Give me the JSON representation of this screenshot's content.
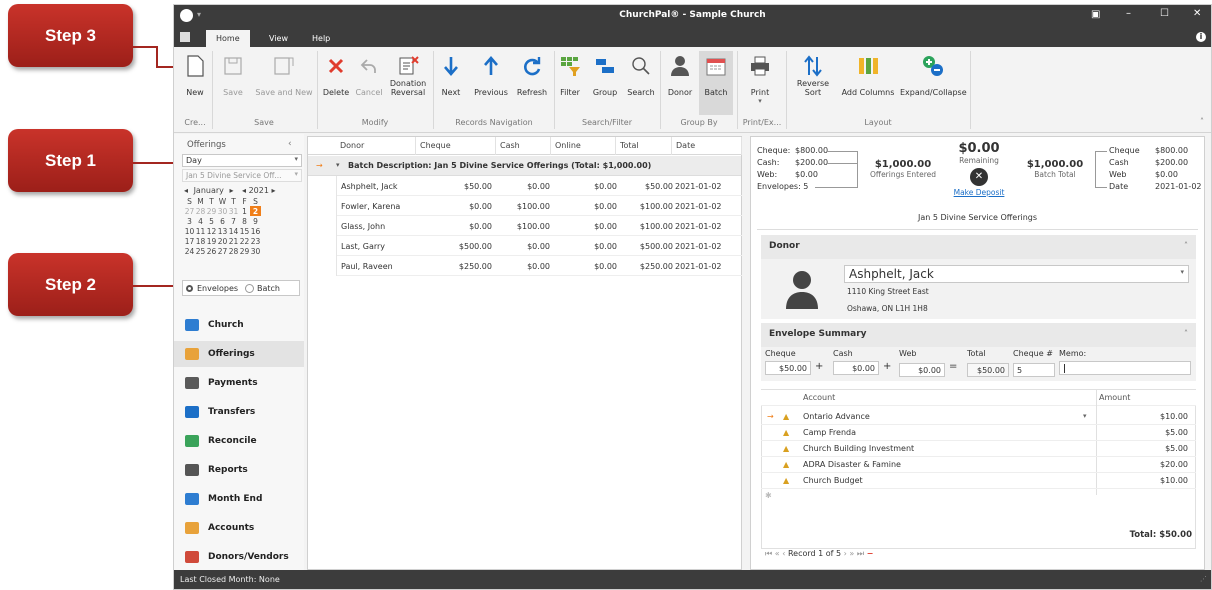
{
  "callouts": {
    "step3": "Step 3",
    "step1": "Step 1",
    "step2": "Step 2"
  },
  "window": {
    "title": "ChurchPal® - Sample Church"
  },
  "tabs": [
    "Home",
    "View",
    "Help"
  ],
  "ribbon": {
    "buttons": {
      "new": "New",
      "save": "Save",
      "save_and_new": "Save and New",
      "delete": "Delete",
      "cancel": "Cancel",
      "donation_reversal_1": "Donation",
      "donation_reversal_2": "Reversal",
      "next": "Next",
      "previous": "Previous",
      "refresh": "Refresh",
      "filter": "Filter",
      "group": "Group",
      "search": "Search",
      "donor": "Donor",
      "batch": "Batch",
      "print": "Print",
      "reverse_sort_1": "Reverse",
      "reverse_sort_2": "Sort",
      "add_columns": "Add Columns",
      "expand_collapse": "Expand/Collapse"
    },
    "groups": {
      "create": "Cre...",
      "save": "Save",
      "modify": "Modify",
      "records_navigation": "Records Navigation",
      "search_filter": "Search/Filter",
      "group_by": "Group By",
      "print_export": "Print/Ex...",
      "layout": "Layout"
    }
  },
  "left": {
    "title": "Offerings",
    "view_select": "Day",
    "batch_select": "Jan 5 Divine Service Off...",
    "calendar": {
      "month": "January",
      "year": "2021",
      "days_header": [
        "S",
        "M",
        "T",
        "W",
        "T",
        "F",
        "S"
      ],
      "weeks": [
        [
          "27",
          "28",
          "29",
          "30",
          "31",
          "1",
          "2"
        ],
        [
          "3",
          "4",
          "5",
          "6",
          "7",
          "8",
          "9"
        ],
        [
          "10",
          "11",
          "12",
          "13",
          "14",
          "15",
          "16"
        ],
        [
          "17",
          "18",
          "19",
          "20",
          "21",
          "22",
          "23"
        ],
        [
          "24",
          "25",
          "26",
          "27",
          "28",
          "29",
          "30"
        ]
      ]
    },
    "radio_envelopes": "Envelopes",
    "radio_batch": "Batch",
    "nav": [
      "Church",
      "Offerings",
      "Payments",
      "Transfers",
      "Reconcile",
      "Reports",
      "Month End",
      "Accounts",
      "Donors/Vendors"
    ]
  },
  "grid": {
    "columns": [
      "Donor",
      "Cheque",
      "Cash",
      "Online",
      "Total",
      "Date"
    ],
    "group_row": "Batch Description: Jan 5 Divine Service Offerings (Total: $1,000.00)",
    "rows": [
      [
        "Ashphelt, Jack",
        "$50.00",
        "$0.00",
        "$0.00",
        "$50.00",
        "2021-01-02"
      ],
      [
        "Fowler, Karena",
        "$0.00",
        "$100.00",
        "$0.00",
        "$100.00",
        "2021-01-02"
      ],
      [
        "Glass, John",
        "$0.00",
        "$100.00",
        "$0.00",
        "$100.00",
        "2021-01-02"
      ],
      [
        "Last, Garry",
        "$500.00",
        "$0.00",
        "$0.00",
        "$500.00",
        "2021-01-02"
      ],
      [
        "Paul, Raveen",
        "$250.00",
        "$0.00",
        "$0.00",
        "$250.00",
        "2021-01-02"
      ]
    ]
  },
  "summary": {
    "left_labels": [
      "Cheque:",
      "Cash:",
      "Web:",
      "Envelopes: 5"
    ],
    "left_values": [
      "$800.00",
      "$200.00",
      "$0.00",
      ""
    ],
    "offerings_entered_amount": "$1,000.00",
    "offerings_entered_label": "Offerings Entered",
    "remaining_amount": "$0.00",
    "remaining_label": "Remaining",
    "make_deposit": "Make Deposit",
    "batch_total_amount": "$1,000.00",
    "batch_total_label": "Batch Total",
    "right_labels": [
      "Cheque",
      "Cash",
      "Web",
      "Date"
    ],
    "right_values": [
      "$800.00",
      "$200.00",
      "$0.00",
      "2021-01-02"
    ],
    "batch_name": "Jan 5 Divine Service Offerings"
  },
  "donor": {
    "header": "Donor",
    "name": "Ashphelt, Jack",
    "address1": "1110 King Street East",
    "address2": "Oshawa, ON L1H 1H8"
  },
  "envelope": {
    "header": "Envelope Summary",
    "labels": [
      "Cheque",
      "Cash",
      "Web",
      "Total",
      "Cheque #",
      "Memo:"
    ],
    "cheque": "$50.00",
    "cash": "$0.00",
    "web": "$0.00",
    "total": "$50.00",
    "cheque_no": "5",
    "memo": "",
    "accounts_header": [
      "Account",
      "Amount"
    ],
    "accounts": [
      [
        "Ontario Advance",
        "$10.00"
      ],
      [
        "Camp Frenda",
        "$5.00"
      ],
      [
        "Church Building Investment",
        "$5.00"
      ],
      [
        "ADRA Disaster & Famine",
        "$20.00"
      ],
      [
        "Church Budget",
        "$10.00"
      ]
    ],
    "total_label": "Total: $50.00",
    "record_nav": "Record 1 of 5"
  },
  "statusbar": "Last Closed Month: None",
  "colors": {
    "accent_red": "#b22a22",
    "titlebar": "#3c3c3c",
    "blue": "#1c6fc7",
    "orange": "#f07f1a"
  }
}
